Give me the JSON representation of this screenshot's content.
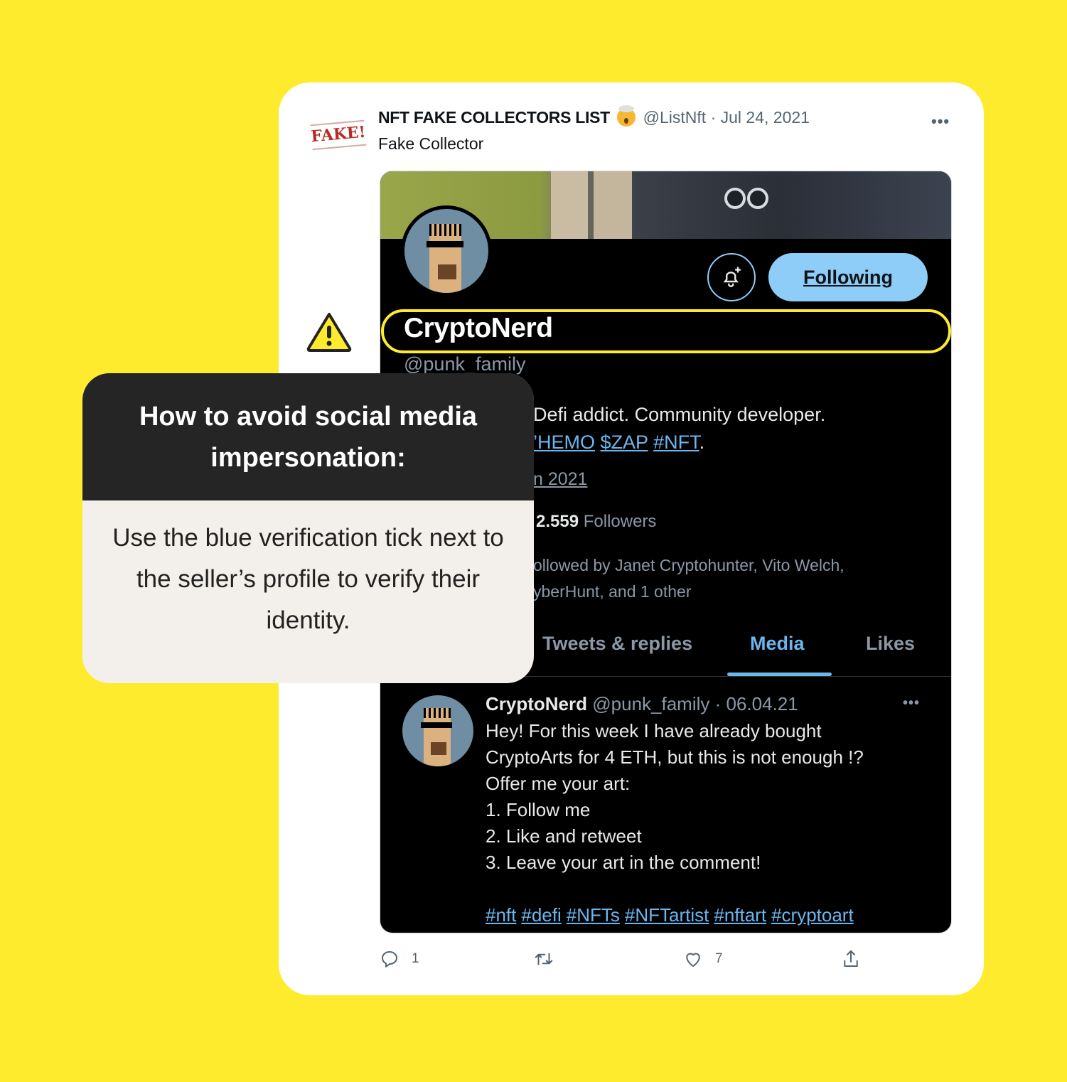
{
  "tweet": {
    "badge_text": "FAKE!",
    "author_name": "NFT FAKE COLLECTORS LIST",
    "author_emoji": "exploding-head-emoji",
    "author_handle": "@ListNft",
    "separator": "·",
    "date": "Jul 24, 2021",
    "text": "Fake Collector",
    "more_icon": "•••",
    "actions": {
      "reply_count": "1",
      "retweet_count": "",
      "like_count": "7"
    }
  },
  "profile": {
    "follow_button": "Following",
    "name": "CryptoNerd",
    "handle": "@punk_family",
    "bio_line1": "Defi addict. Community developer.",
    "bio_tags": [
      "#HEMO",
      "$ZAP",
      "#NFT"
    ],
    "bio_tag_visible": [
      "’HEMO",
      "$ZAP",
      "#NFT"
    ],
    "bio_end": ".",
    "joined": "n 2021",
    "followers_count": "2.559",
    "followers_label": "Followers",
    "followed_by_line1": "ollowed by Janet Cryptohunter, Vito Welch,",
    "followed_by_line2": "yberHunt, and 1 other",
    "tabs": [
      {
        "label": "Tweets & replies",
        "active": false
      },
      {
        "label": "Media",
        "active": true
      },
      {
        "label": "Likes",
        "active": false
      }
    ]
  },
  "embedded_tweet": {
    "name": "CryptoNerd",
    "handle": "@punk_family",
    "date": "06.04.21",
    "more_icon": "•••",
    "lines": [
      "Hey! For this week I have already bought",
      "CryptoArts for 4 ETH, but this is not enough !?",
      "Offer me your art:",
      "1. Follow me",
      "2. Like and retweet",
      "3. Leave your art in the comment!"
    ],
    "hashtags": [
      "#nft",
      "#defi",
      "#NFTs",
      "#NFTartist",
      "#nftart",
      "#cryptoart"
    ]
  },
  "tip_card": {
    "title": "How to avoid social media impersonation:",
    "body": "Use the blue verification tick next to the seller’s profile to verify their identity."
  },
  "colors": {
    "background": "#FFEB2D",
    "link": "#6cb6ef",
    "follow_button": "#8ecdf8",
    "tip_header": "#252525",
    "tip_body": "#f3f0eb"
  }
}
